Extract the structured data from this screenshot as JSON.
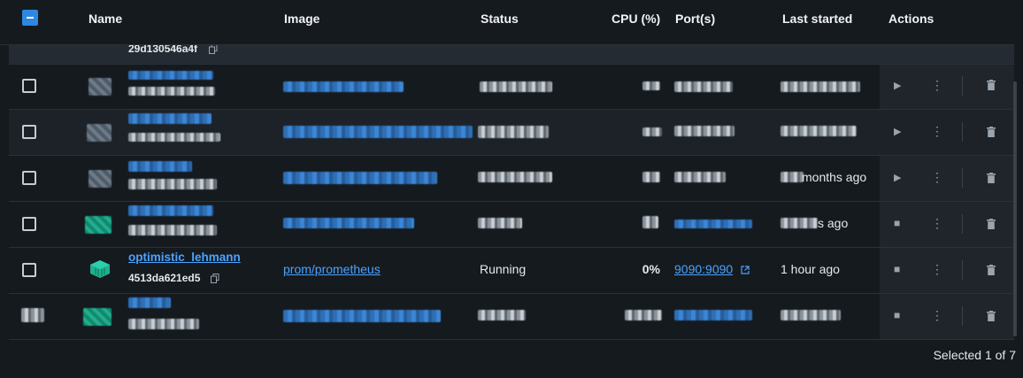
{
  "header": {
    "name": "Name",
    "image": "Image",
    "status": "Status",
    "cpu": "CPU (%)",
    "ports": "Port(s)",
    "last_started": "Last started",
    "actions": "Actions"
  },
  "rows": [
    {
      "id": "29d130546a4f"
    },
    {},
    {},
    {
      "last_started": "months ago"
    },
    {
      "last_started": "s ago"
    },
    {
      "name": "optimistic_lehmann",
      "id": "4513da621ed5",
      "image": "prom/prometheus",
      "status": "Running",
      "cpu": "0%",
      "port": "9090:9090",
      "last_started": "1 hour ago"
    },
    {}
  ],
  "footer": {
    "selection": "Selected 1 of 7"
  },
  "colors": {
    "accent": "#2f87e0",
    "link": "#4aa3ff",
    "running_icon": "#1fb08f",
    "background": "#151a1f"
  }
}
